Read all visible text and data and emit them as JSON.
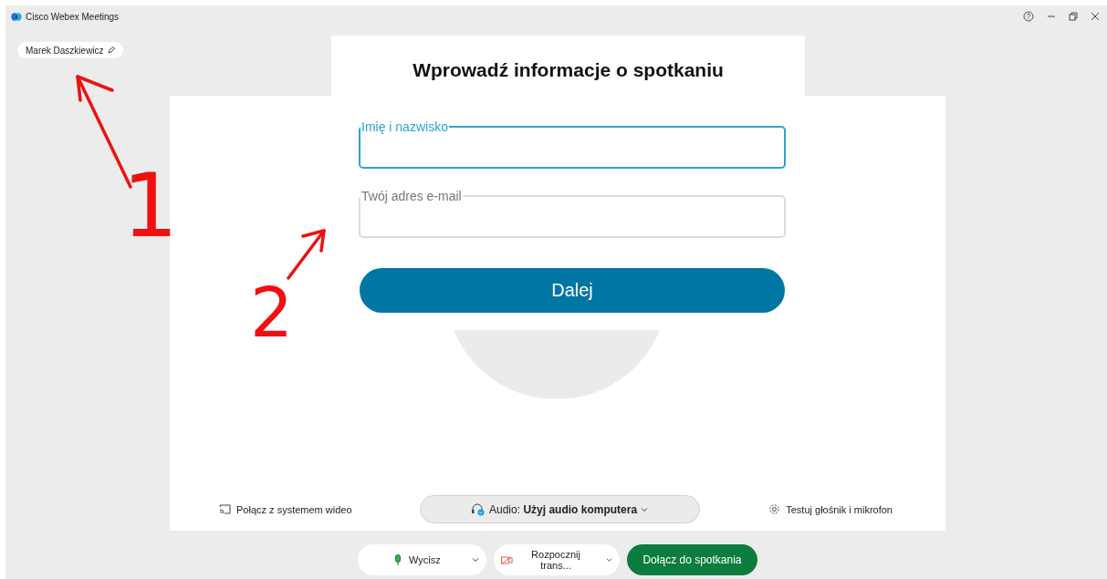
{
  "window": {
    "title": "Cisco Webex Meetings"
  },
  "user_chip": {
    "name": "Marek Daszkiewicz"
  },
  "dialog": {
    "title": "Wprowadź informacje o spotkaniu",
    "fields": [
      {
        "label": "Imię i nazwisko",
        "focused": true
      },
      {
        "label": "Twój adres e-mail",
        "focused": false
      }
    ],
    "submit": "Dalej"
  },
  "panel_actions": {
    "video_system": "Połącz z systemem wideo",
    "audio": "Audio: **Użyj audio komputera**",
    "test_audio": "Testuj głośnik i mikrofon"
  },
  "toolbar": [
    {
      "kind": "mute",
      "label": "Wycisz"
    },
    {
      "kind": "video",
      "label": "Rozpocznij trans..."
    },
    {
      "kind": "join",
      "label": "Dołącz do spotkania"
    }
  ],
  "annotations": [
    {
      "label": "1"
    },
    {
      "label": "2"
    }
  ]
}
